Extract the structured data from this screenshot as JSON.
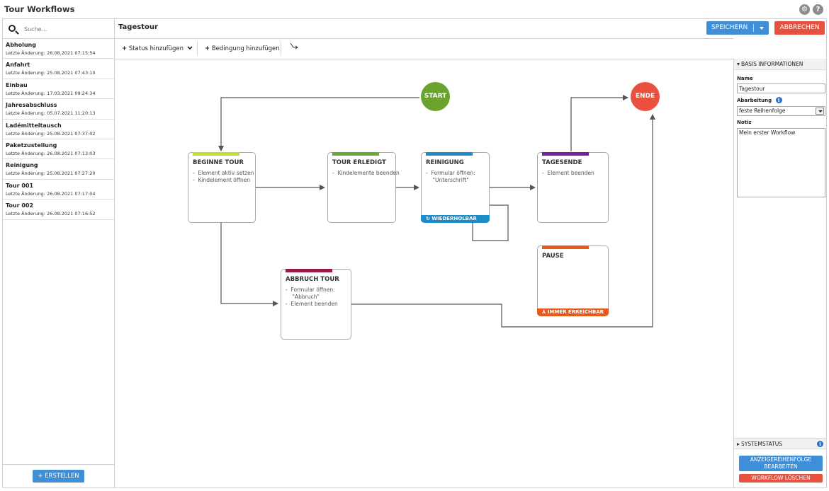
{
  "app": {
    "title": "Tour Workflows",
    "icons": [
      "settings-icon",
      "help-icon"
    ]
  },
  "sidebar": {
    "search_placeholder": "Suche...",
    "items": [
      {
        "name": "Abholung",
        "date": "Letzte Änderung: 26.08.2021 07:15:54"
      },
      {
        "name": "Anfahrt",
        "date": "Letzte Änderung: 25.08.2021 07:43:10"
      },
      {
        "name": "Einbau",
        "date": "Letzte Änderung: 17.03.2021 09:24:34"
      },
      {
        "name": "Jahresabschluss",
        "date": "Letzte Änderung: 05.07.2021 11:20:13"
      },
      {
        "name": "Ladémitteltausch",
        "date": "Letzte Änderung: 25.08.2021 07:37:02"
      },
      {
        "name": "Paketzustellung",
        "date": "Letzte Änderung: 26.08.2021 07:13:03"
      },
      {
        "name": "Reinigung",
        "date": "Letzte Änderung: 25.08.2021 07:27:20"
      },
      {
        "name": "Tour 001",
        "date": "Letzte Änderung: 26.08.2021 07:17:04"
      },
      {
        "name": "Tour 002",
        "date": "Letzte Änderung: 26.08.2021 07:16:52"
      }
    ],
    "create_label": "+ ERSTELLEN"
  },
  "header": {
    "workflow_title": "Tagestour",
    "save_label": "SPEICHERN",
    "cancel_label": "ABBRECHEN"
  },
  "toolbar": {
    "add_status_label": "Status hinzufügen",
    "add_condition_label": "Bedingung hinzufügen"
  },
  "canvas": {
    "start_label": "START",
    "end_label": "ENDE",
    "nodes": {
      "beginne": {
        "title": "BEGINNE TOUR",
        "lines": [
          "-  Element aktiv setzen",
          "-  Kindelement öffnen"
        ],
        "color": "#c8dc2e"
      },
      "erledigt": {
        "title": "TOUR ERLEDIGT",
        "lines": [
          "-  Kindelemente beenden"
        ],
        "color": "#6aa83a"
      },
      "reinigung": {
        "title": "REINIGUNG",
        "lines": [
          "-  Formular öffnen:",
          "    \"Unterschrift\""
        ],
        "color": "#1e8cc9",
        "footer": "WIEDERHOLBAR"
      },
      "tagesende": {
        "title": "TAGESENDE",
        "lines": [
          "-  Element beenden"
        ],
        "color": "#7a1ea0"
      },
      "pause": {
        "title": "PAUSE",
        "lines": [],
        "color": "#e8591e",
        "footer": "IMMER ERREICHBAR"
      },
      "abbruch": {
        "title": "ABBRUCH TOUR",
        "lines": [
          "-  Formular öffnen:",
          "    \"Abbruch\"",
          "-  Element beenden"
        ],
        "color": "#9a1a45"
      }
    },
    "colors": {
      "start": "#6aa22e",
      "end": "#e8513f"
    }
  },
  "right_panel": {
    "basis_header": "BASIS INFORMATIONEN",
    "name_label": "Name",
    "name_value": "Tagestour",
    "processing_label": "Abarbeitung",
    "processing_value": "feste Reihenfolge",
    "note_label": "Notiz",
    "note_value": "Mein erster Workflow",
    "system_header": "SYSTEMSTATUS",
    "order_button": "ANZEIGEREIHENFOLGE BEARBEITEN",
    "delete_button": "WORKFLOW LÖSCHEN"
  }
}
